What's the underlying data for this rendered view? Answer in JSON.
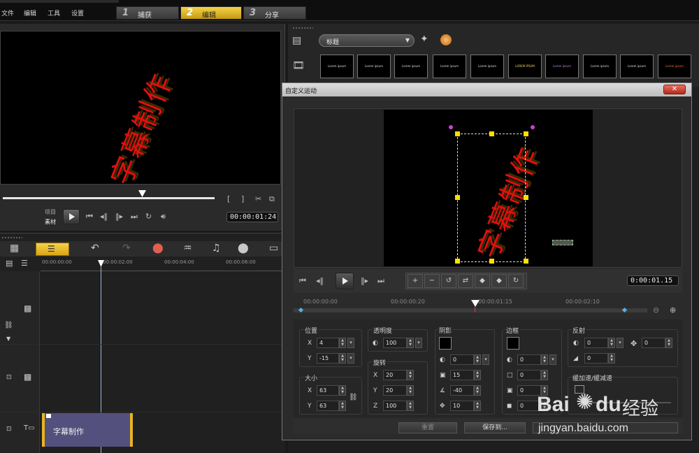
{
  "menu": {
    "file": "文件",
    "edit": "编辑",
    "tools": "工具",
    "settings": "设置"
  },
  "steps": [
    {
      "num": "1",
      "label": "捕获"
    },
    {
      "num": "2",
      "label": "编辑"
    },
    {
      "num": "3",
      "label": "分享"
    }
  ],
  "preview": {
    "caption": "字幕制作",
    "mode_project": "项目",
    "mode_clip": "素材",
    "timecode": "00:00:01:24"
  },
  "library": {
    "category": "标题",
    "thumbs": [
      "Lorem ipsum",
      "Lorem ipsum",
      "Lorem ipsum",
      "Lorem ipsum",
      "Lorem ipsum",
      "LOREM IPSUM",
      "Lorem ipsum",
      "Lorem ipsum",
      "Lorem ipsum",
      "Lorem ipsum"
    ]
  },
  "timeline": {
    "ruler": [
      "00:00:00:00",
      "00:00:02:00",
      "00:00:04:00",
      "00:00:06:00"
    ],
    "clip_label": "字幕制作"
  },
  "dialog": {
    "title": "自定义运动",
    "caption": "字幕制作",
    "timecode": "0:00:01.15",
    "ruler": [
      "00:00:00:00",
      "00:00:00:20",
      "00:00:01:15",
      "00:00:02:10"
    ],
    "position": {
      "title": "位置",
      "x_label": "X",
      "x": "4",
      "y_label": "Y",
      "y": "-15"
    },
    "size": {
      "title": "大小",
      "x_label": "X",
      "x": "63",
      "y_label": "Y",
      "y": "63"
    },
    "opacity": {
      "title": "透明度",
      "value": "100"
    },
    "rotation": {
      "title": "旋转",
      "x_label": "X",
      "x": "20",
      "y_label": "Y",
      "y": "20",
      "z_label": "Z",
      "z": "100"
    },
    "shadow": {
      "title": "阴影",
      "v1": "0",
      "v2": "15",
      "v3": "-40",
      "v4": "10"
    },
    "border": {
      "title": "边框",
      "v1": "0",
      "v2": "0",
      "v3": "0",
      "v4": "0"
    },
    "reflection": {
      "title": "反射",
      "v1": "0",
      "v2": "0",
      "v3": "0"
    },
    "easing": {
      "title": "缓加速/缓减速"
    },
    "reset_label": "重置",
    "save_label": "保存到..."
  },
  "watermark": {
    "brand": "Bai",
    "brand2": "du",
    "cn": "经验",
    "url": "jingyan.baidu.com"
  }
}
